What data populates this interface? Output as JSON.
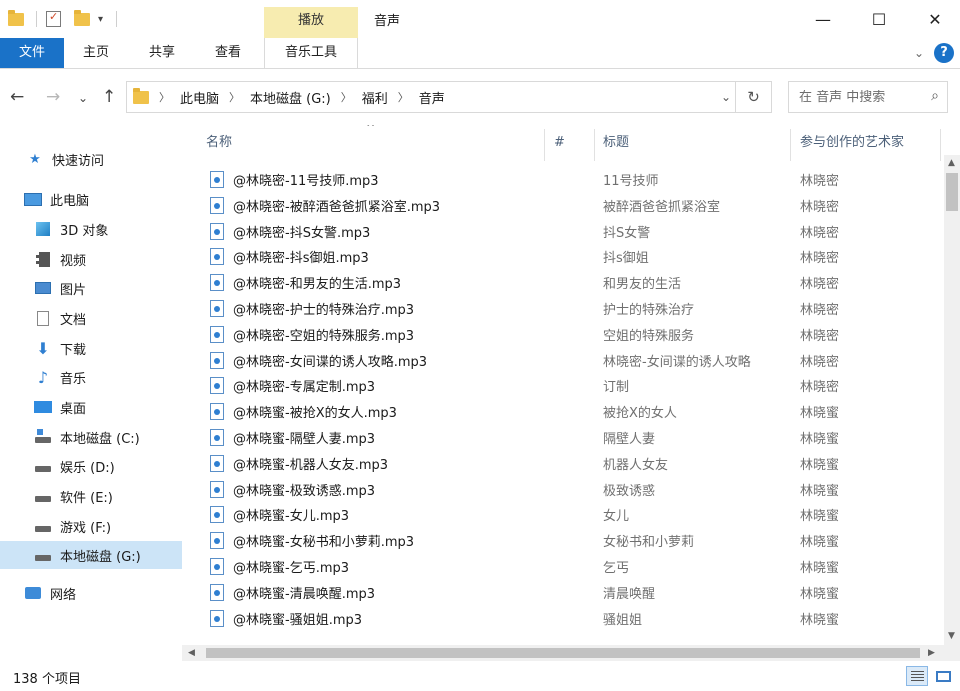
{
  "window": {
    "title": "音声",
    "context_group": "播放",
    "controls": {
      "minimize": "—",
      "maximize": "☐",
      "close": "✕"
    }
  },
  "ribbon": {
    "tabs": [
      "文件",
      "主页",
      "共享",
      "查看",
      "音乐工具"
    ],
    "help_label": "?"
  },
  "address": {
    "crumbs": [
      "此电脑",
      "本地磁盘 (G:)",
      "福利",
      "音声"
    ],
    "back": "←",
    "forward": "→",
    "recent": "⌄",
    "up": "↑",
    "refresh": "↻",
    "dropdown": "⌄"
  },
  "search": {
    "placeholder": "在 音声 中搜索",
    "icon": "⌕"
  },
  "nav": {
    "items": [
      {
        "label": "快速访问",
        "icon": "star-icon"
      },
      {
        "label": "此电脑",
        "icon": "computer-icon"
      },
      {
        "label": "3D 对象",
        "icon": "cube-icon"
      },
      {
        "label": "视频",
        "icon": "video-icon"
      },
      {
        "label": "图片",
        "icon": "picture-icon"
      },
      {
        "label": "文档",
        "icon": "document-icon"
      },
      {
        "label": "下载",
        "icon": "download-icon"
      },
      {
        "label": "音乐",
        "icon": "music-icon"
      },
      {
        "label": "桌面",
        "icon": "desktop-icon"
      },
      {
        "label": "本地磁盘 (C:)",
        "icon": "system-drive-icon"
      },
      {
        "label": "娱乐 (D:)",
        "icon": "drive-icon"
      },
      {
        "label": "软件 (E:)",
        "icon": "drive-icon"
      },
      {
        "label": "游戏 (F:)",
        "icon": "drive-icon"
      },
      {
        "label": "本地磁盘 (G:)",
        "icon": "drive-icon",
        "selected": true
      },
      {
        "label": "网络",
        "icon": "network-icon"
      }
    ]
  },
  "columns": {
    "name": "名称",
    "number": "#",
    "title": "标题",
    "artist": "参与创作的艺术家",
    "sort_indicator": "^"
  },
  "files": [
    {
      "name": "@林晓密-11号技师.mp3",
      "title": "11号技师",
      "artist": "林晓密"
    },
    {
      "name": "@林晓密-被醉酒爸爸抓紧浴室.mp3",
      "title": "被醉酒爸爸抓紧浴室",
      "artist": "林晓密"
    },
    {
      "name": "@林晓密-抖S女警.mp3",
      "title": "抖S女警",
      "artist": "林晓密"
    },
    {
      "name": "@林晓密-抖s御姐.mp3",
      "title": "抖s御姐",
      "artist": "林晓密"
    },
    {
      "name": "@林晓密-和男友的生活.mp3",
      "title": "和男友的生活",
      "artist": "林晓密"
    },
    {
      "name": "@林晓密-护士的特殊治疗.mp3",
      "title": "护士的特殊治疗",
      "artist": "林晓密"
    },
    {
      "name": "@林晓密-空姐的特殊服务.mp3",
      "title": "空姐的特殊服务",
      "artist": "林晓密"
    },
    {
      "name": "@林晓密-女间谍的诱人攻略.mp3",
      "title": "林晓密-女间谍的诱人攻略",
      "artist": "林晓密"
    },
    {
      "name": "@林晓密-专属定制.mp3",
      "title": "订制",
      "artist": "林晓密"
    },
    {
      "name": "@林晓蜜-被抢X的女人.mp3",
      "title": "被抢X的女人",
      "artist": "林晓蜜"
    },
    {
      "name": "@林晓蜜-隔壁人妻.mp3",
      "title": "隔壁人妻",
      "artist": "林晓蜜"
    },
    {
      "name": "@林晓蜜-机器人女友.mp3",
      "title": "机器人女友",
      "artist": "林晓蜜"
    },
    {
      "name": "@林晓蜜-极致诱惑.mp3",
      "title": "极致诱惑",
      "artist": "林晓蜜"
    },
    {
      "name": "@林晓蜜-女儿.mp3",
      "title": "女儿",
      "artist": "林晓蜜"
    },
    {
      "name": "@林晓蜜-女秘书和小萝莉.mp3",
      "title": "女秘书和小萝莉",
      "artist": "林晓蜜"
    },
    {
      "name": "@林晓蜜-乞丐.mp3",
      "title": "乞丐",
      "artist": "林晓蜜"
    },
    {
      "name": "@林晓蜜-清晨唤醒.mp3",
      "title": "清晨唤醒",
      "artist": "林晓蜜"
    },
    {
      "name": "@林晓蜜-骚姐姐.mp3",
      "title": "骚姐姐",
      "artist": "林晓蜜"
    }
  ],
  "status": {
    "item_count": "138 个项目"
  }
}
